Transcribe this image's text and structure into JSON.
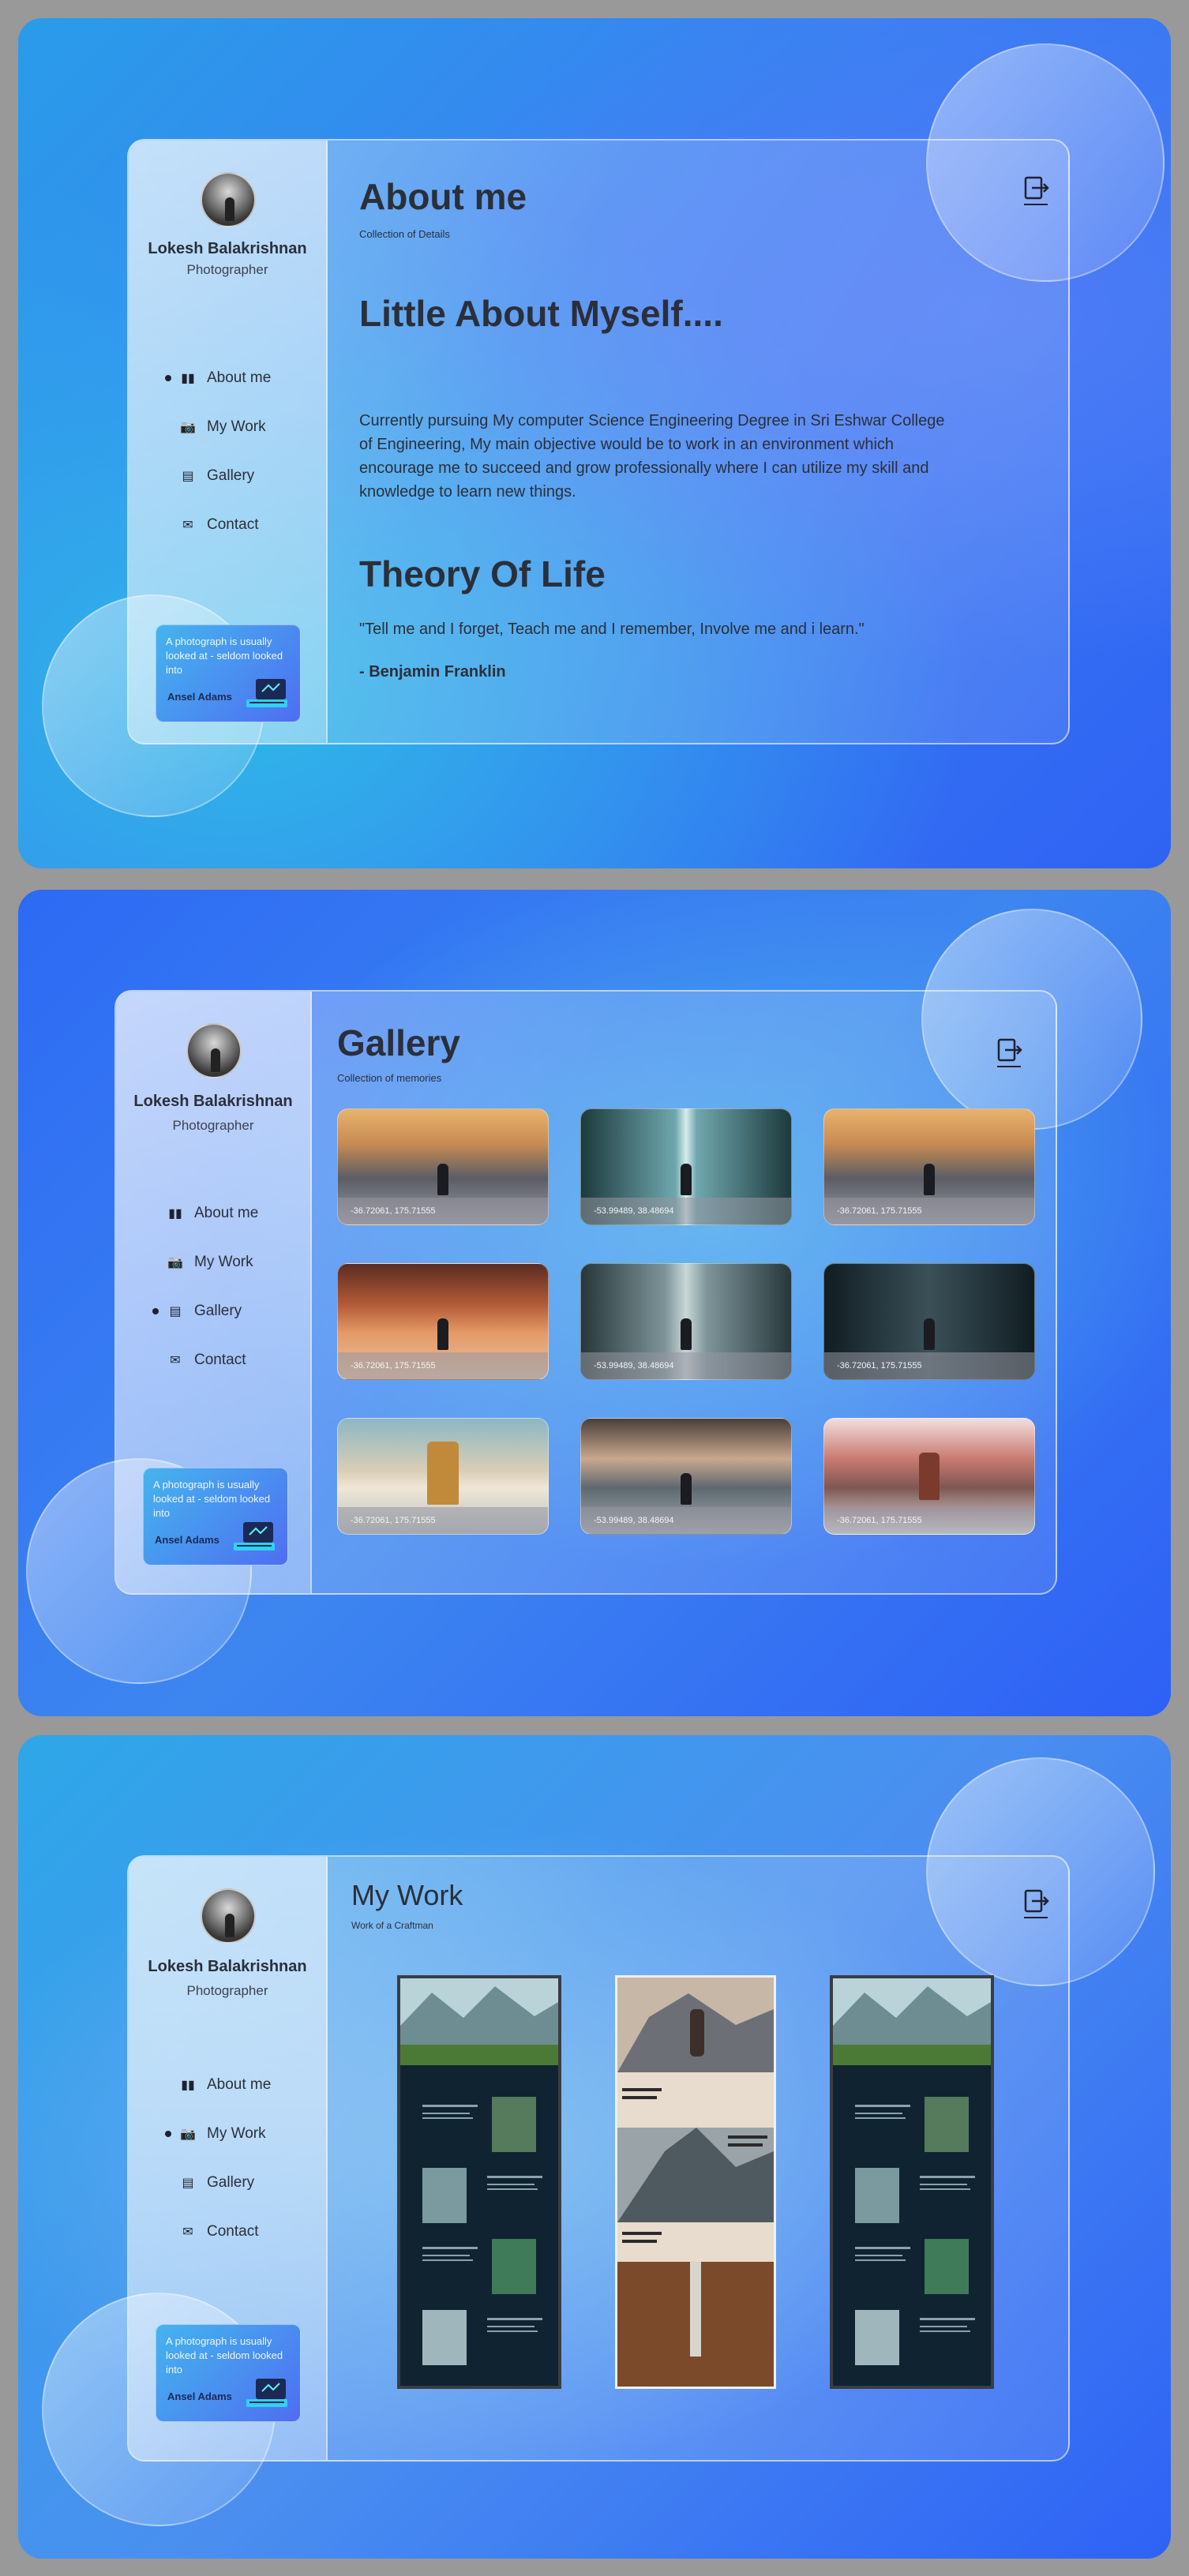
{
  "profile": {
    "name": "Lokesh Balakrishnan",
    "role": "Photographer"
  },
  "nav": [
    {
      "label": "About me",
      "icon": "book-icon"
    },
    {
      "label": "My Work",
      "icon": "camera-icon"
    },
    {
      "label": "Gallery",
      "icon": "gallery-icon"
    },
    {
      "label": "Contact",
      "icon": "mail-icon"
    }
  ],
  "quote_card": {
    "text": "A photograph is usually looked at - seldom looked into",
    "author": "Ansel Adams"
  },
  "about": {
    "title": "About me",
    "subtitle": "Collection of Details",
    "heading": "Little About Myself....",
    "paragraph": "Currently pursuing My computer Science Engineering Degree in Sri Eshwar College of Engineering, My main objective would be to work in an environment which encourage me to succeed and grow professionally where I can utilize my skill and knowledge to learn new things.",
    "theory_heading": "Theory Of Life",
    "quote": "\"Tell me and I forget, Teach me and I remember, Involve me and i learn.\"",
    "quote_author": "- Benjamin Franklin"
  },
  "gallery": {
    "title": "Gallery",
    "subtitle": "Collection of memories",
    "tiles": [
      {
        "caption": "-36.72061, 175.71555",
        "palette": "sunset-mountain"
      },
      {
        "caption": "-53.99489, 38.48694",
        "palette": "waterfall"
      },
      {
        "caption": "-36.72061, 175.71555",
        "palette": "sunset-mountain"
      },
      {
        "caption": "-36.72061, 175.71555",
        "palette": "desert"
      },
      {
        "caption": "-53.99489, 38.48694",
        "palette": "misty-forest"
      },
      {
        "caption": "-36.72061, 175.71555",
        "palette": "dark-forest"
      },
      {
        "caption": "-36.72061, 175.71555",
        "palette": "ocean-wave"
      },
      {
        "caption": "-53.99489, 38.48694",
        "palette": "storm-wave"
      },
      {
        "caption": "-36.72061, 175.71555",
        "palette": "pink-mountain"
      }
    ]
  },
  "work": {
    "title": "My Work",
    "subtitle": "Work of a Craftman",
    "shots": [
      {
        "theme": "dark"
      },
      {
        "theme": "light"
      },
      {
        "theme": "dark"
      }
    ]
  },
  "colors": {
    "accent": "#2f63f3",
    "text": "#2b2f3a",
    "panel_border": "#ffffff"
  }
}
